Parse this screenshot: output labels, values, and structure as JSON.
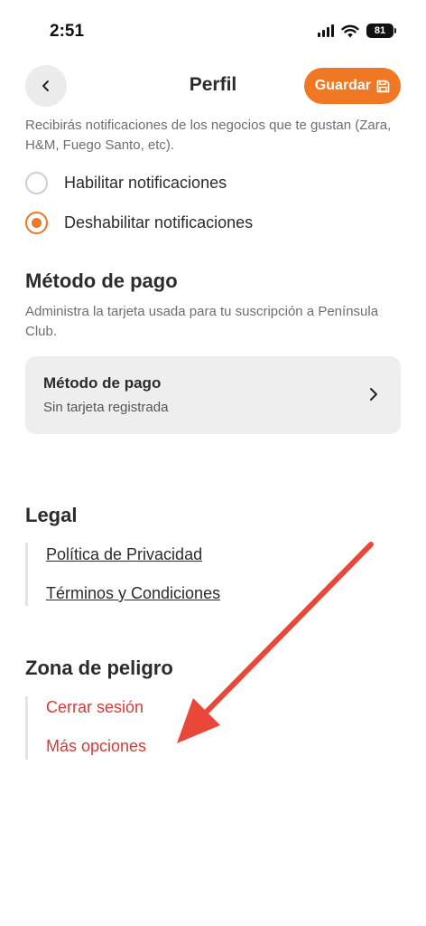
{
  "status_bar": {
    "time": "2:51",
    "battery": "81"
  },
  "header": {
    "title": "Perfil",
    "save_label": "Guardar"
  },
  "notifications": {
    "description": "Recibirás notificaciones de los negocios que te gustan (Zara, H&M, Fuego Santo, etc).",
    "options": [
      {
        "label": "Habilitar notificaciones",
        "selected": false
      },
      {
        "label": "Deshabilitar notificaciones",
        "selected": true
      }
    ]
  },
  "payment": {
    "section_title": "Método de pago",
    "description": "Administra la tarjeta usada para tu suscripción a Península Club.",
    "card_title": "Método de pago",
    "card_subtitle": "Sin tarjeta registrada"
  },
  "legal": {
    "section_title": "Legal",
    "links": [
      "Política de Privacidad",
      "Términos y Condiciones"
    ]
  },
  "danger_zone": {
    "section_title": "Zona de peligro",
    "links": [
      "Cerrar sesión",
      "Más opciones"
    ]
  },
  "colors": {
    "accent": "#f07822",
    "danger": "#d33b3b",
    "annotation_arrow": "#e8473a"
  }
}
